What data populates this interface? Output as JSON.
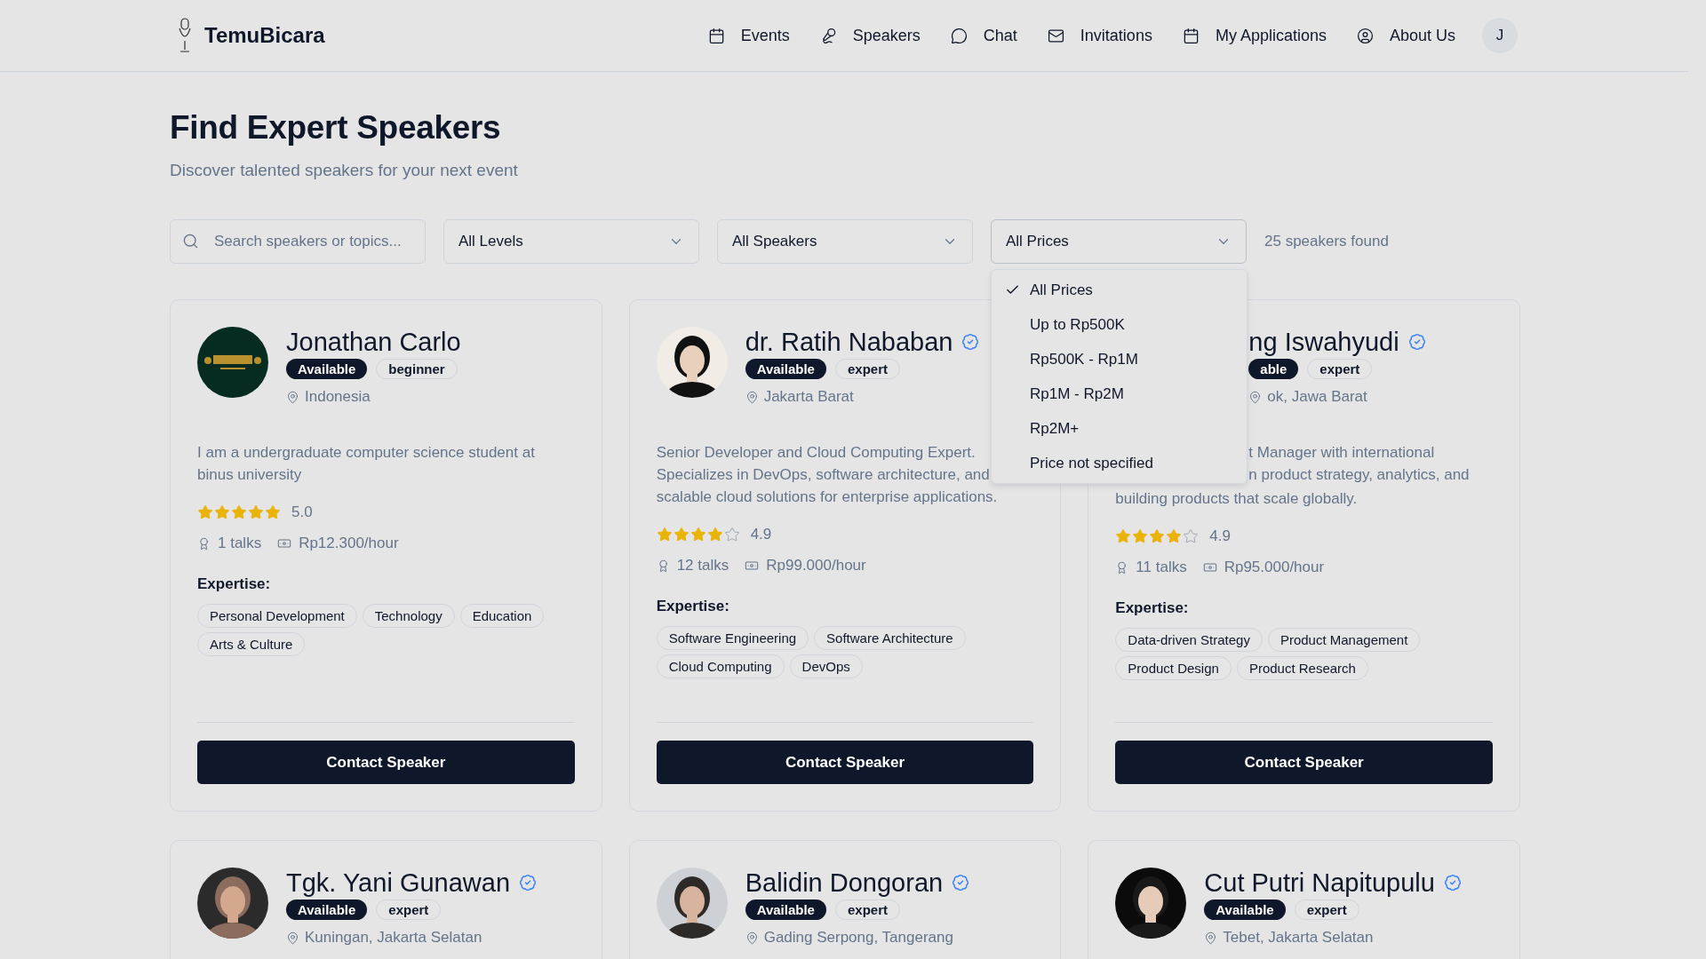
{
  "brand": {
    "name": "TemuBicara"
  },
  "nav": [
    {
      "label": "Events",
      "kind": "calendar"
    },
    {
      "label": "Speakers",
      "kind": "mic"
    },
    {
      "label": "Chat",
      "kind": "chat"
    },
    {
      "label": "Invitations",
      "kind": "mail"
    },
    {
      "label": "My Applications",
      "kind": "calendar"
    },
    {
      "label": "About Us",
      "kind": "user"
    }
  ],
  "user": {
    "initial": "J"
  },
  "header": {
    "title": "Find Expert Speakers",
    "subtitle": "Discover talented speakers for your next event"
  },
  "filters": {
    "search": {
      "placeholder": "Search speakers or topics..."
    },
    "selects": [
      {
        "value": "All Levels",
        "expanded": false
      },
      {
        "value": "All Speakers",
        "expanded": false
      },
      {
        "value": "All Prices",
        "expanded": true
      }
    ],
    "count": "25 speakers found"
  },
  "price_menu": {
    "options": [
      {
        "label": "All Prices",
        "selected": true
      },
      {
        "label": "Up to Rp500K",
        "selected": false
      },
      {
        "label": "Rp500K - Rp1M",
        "selected": false
      },
      {
        "label": "Rp1M - Rp2M",
        "selected": false
      },
      {
        "label": "Rp2M+",
        "selected": false
      },
      {
        "label": "Price not specified",
        "selected": false
      }
    ]
  },
  "speakers": [
    {
      "name": "Jonathan Carlo",
      "verified": false,
      "status": "Available",
      "level": "beginner",
      "location": "Indonesia",
      "bio": "I am a undergraduate computer science student at binus university",
      "stars": 5,
      "rating": "5.0",
      "talks": "1 talks",
      "price": "Rp12.300/hour",
      "expertise_label": "Expertise:",
      "expertise": [
        "Personal Development",
        "Technology",
        "Education",
        "Arts & Culture"
      ],
      "action": "Contact Speaker"
    },
    {
      "name": "dr. Ratih Nababan",
      "verified": true,
      "status": "Available",
      "level": "expert",
      "location": "Jakarta Barat",
      "bio": "Senior Developer and Cloud Computing Expert. Specializes in DevOps, software architecture, and scalable cloud solutions for enterprise applications.",
      "stars": 4,
      "rating": "4.9",
      "talks": "12 talks",
      "price": "Rp99.000/hour",
      "expertise_label": "Expertise:",
      "expertise": [
        "Software Engineering",
        "Software Architecture",
        "Cloud Computing",
        "DevOps"
      ],
      "action": "Contact Speaker"
    },
    {
      "covered": true,
      "name": "ng Iswahyudi",
      "verified": true,
      "status": "able",
      "level": "expert",
      "location": "ok, Jawa Barat",
      "bio_lines": [
        {
          "text": "t Manager with international",
          "covered": true
        },
        {
          "text": "n product strategy, analytics, and",
          "covered": true
        },
        {
          "text": "building products that scale globally.",
          "covered": false
        }
      ],
      "stars": 4,
      "rating": "4.9",
      "talks": "11 talks",
      "price": "Rp95.000/hour",
      "expertise_label": "Expertise:",
      "expertise": [
        "Data-driven Strategy",
        "Product Management",
        "Product Design",
        "Product Research"
      ],
      "action": "Contact Speaker"
    },
    {
      "name": "Tgk. Yani Gunawan",
      "verified": true,
      "status": "Available",
      "level": "expert",
      "location": "Kuningan, Jakarta Selatan"
    },
    {
      "name": "Balidin Dongoran",
      "verified": true,
      "status": "Available",
      "level": "expert",
      "location": "Gading Serpong, Tangerang"
    },
    {
      "name": "Cut Putri Napitupulu",
      "verified": true,
      "status": "Available",
      "level": "expert",
      "location": "Tebet, Jakarta Selatan"
    }
  ]
}
